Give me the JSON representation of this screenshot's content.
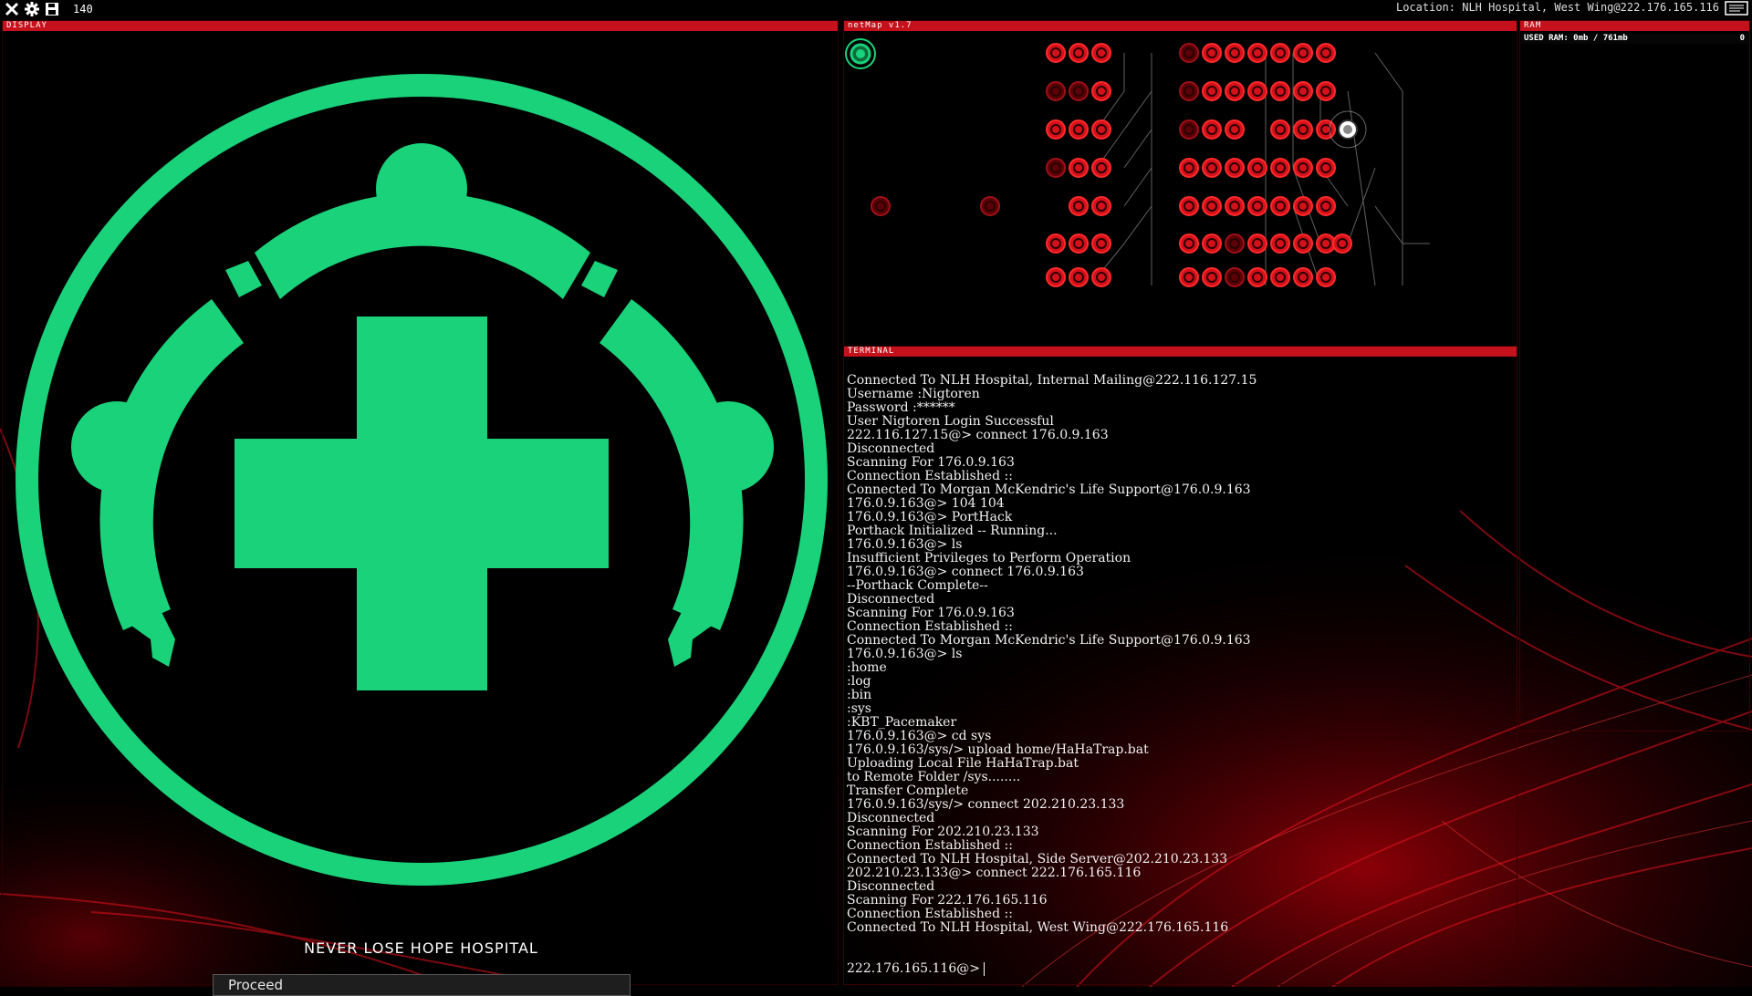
{
  "topbar": {
    "exit_icon": "close-icon",
    "settings_icon": "gear-icon",
    "save_icon": "save-icon",
    "count": "140",
    "location": "Location: NLH Hospital, West Wing@222.176.165.116",
    "mail_icon": "mail-icon"
  },
  "display": {
    "header": "DISPLAY",
    "logo": "medical-cross-logo",
    "company_name": "NEVER LOSE HOPE HOSPITAL",
    "proceed_label": "Proceed"
  },
  "netmap": {
    "header": "netMap v1.7"
  },
  "terminal": {
    "header": "TERMINAL",
    "lines": [
      "Connected To NLH Hospital, Internal Mailing@222.116.127.15",
      "Username :Nigtoren",
      "Password :******",
      "User Nigtoren Login Successful",
      "222.116.127.15@> connect 176.0.9.163",
      "Disconnected",
      "Scanning For 176.0.9.163",
      "Connection Established ::",
      "Connected To Morgan McKendric's Life Support@176.0.9.163",
      "176.0.9.163@> 104 104",
      "176.0.9.163@> PortHack",
      "Porthack Initialized -- Running...",
      "176.0.9.163@> ls",
      "Insufficient Privileges to Perform Operation",
      "176.0.9.163@> connect 176.0.9.163",
      "--Porthack Complete--",
      "Disconnected",
      "Scanning For 176.0.9.163",
      "Connection Established ::",
      "Connected To Morgan McKendric's Life Support@176.0.9.163",
      "176.0.9.163@> ls",
      ":home",
      ":log",
      ":bin",
      ":sys",
      ":KBT_Pacemaker",
      "176.0.9.163@> cd sys",
      "176.0.9.163/sys/> upload home/HaHaTrap.bat",
      "Uploading Local File HaHaTrap.bat",
      "to Remote Folder /sys........",
      "Transfer Complete",
      "176.0.9.163/sys/> connect 202.210.23.133",
      "Disconnected",
      "Scanning For 202.210.23.133",
      "Connection Established ::",
      "Connected To NLH Hospital, Side Server@202.210.23.133",
      "202.210.23.133@> connect 222.176.165.116",
      "Disconnected",
      "Scanning For 222.176.165.116",
      "Connection Established ::",
      "Connected To NLH Hospital, West Wing@222.176.165.116"
    ],
    "prompt": "222.176.165.116@>"
  },
  "ram": {
    "header": "RAM",
    "used_label": "USED RAM: 0mb / 761mb",
    "count": "0"
  },
  "colors": {
    "accent_red": "#c4111b",
    "logo_green": "#19d27a",
    "background": "#000000"
  }
}
